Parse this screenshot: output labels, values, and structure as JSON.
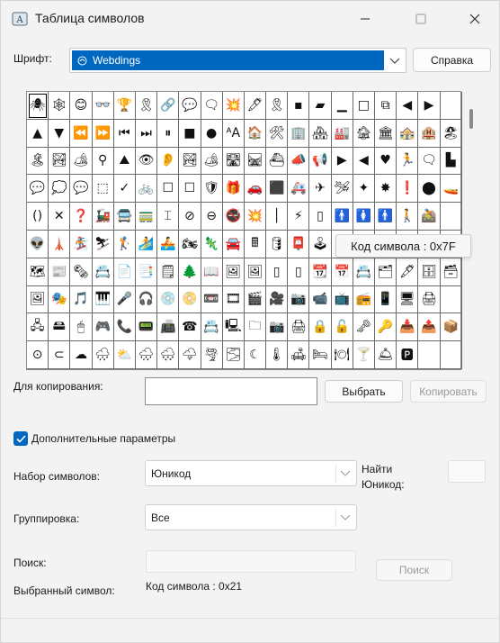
{
  "window": {
    "title": "Таблица символов",
    "icon": "character-map-icon"
  },
  "font": {
    "label": "Шрифт:",
    "value": "Webdings",
    "help_button": "Справка"
  },
  "grid": {
    "selected_index": 0,
    "symbols": [
      "🕷",
      "🕸",
      "😊",
      "👓",
      "🏆",
      "🎗",
      "🔗",
      "💬",
      "🗨",
      "💥",
      "🖊",
      "🎗",
      "▪",
      "▰",
      "▁",
      "□",
      "⧉",
      "◀",
      "▶",
      "",
      "▲",
      "▼",
      "⏪",
      "⏩",
      "⏮",
      "⏭",
      "⏸",
      "■",
      "●",
      "ᴬA",
      "🏠",
      "🛠",
      "🏢",
      "🏘",
      "🏭",
      "🏚",
      "🏛",
      "🏤",
      "🏨",
      "🏖",
      "🏝",
      "🏞",
      "🏕",
      "⚲",
      "⛰",
      "👁",
      "👂",
      "🏞",
      "🏕",
      "🛣",
      "🛤",
      "⛴",
      "📣",
      "📢",
      "▶",
      "◀",
      "♥",
      "🏃",
      "🗨",
      "▙",
      "💬",
      "💭",
      "💬",
      "⬚",
      "✓",
      "🚲",
      "☐",
      "☐",
      "🛡",
      "🎁",
      "🚗",
      "⬛",
      "🚑",
      "✈",
      "🛩",
      "✦",
      "✸",
      "❗",
      "⬤",
      "🚤",
      "()",
      "✕",
      "❓",
      "🚂",
      "🚍",
      "🚃",
      "⌶",
      "⊘",
      "⊖",
      "🚭",
      "💥",
      "│",
      "⚡",
      "▯",
      "🚹",
      "🚺",
      "🚹",
      "🚶",
      "🚵",
      "",
      "👽",
      "🗼",
      "🏂",
      "⛷",
      "🏌",
      "🏄",
      "🚣",
      "🏍",
      "🦎",
      "🚘",
      "🖩",
      "🛢",
      "📮",
      "🕹",
      "🕹",
      "",
      "",
      "",
      "",
      "",
      "🗺",
      "📰",
      "🗞",
      "📇",
      "📄",
      "📑",
      "🗒",
      "🌲",
      "📖",
      "🖼",
      "🖼",
      "▯",
      "▯",
      "📆",
      "📅",
      "📇",
      "🗂",
      "🖋",
      "🗄",
      "🗃",
      "🖼",
      "🎭",
      "🎵",
      "🎹",
      "🎤",
      "🎧",
      "💿",
      "📀",
      "📼",
      "🎞",
      "🎬",
      "🎥",
      "📷",
      "📹",
      "📺",
      "📻",
      "📱",
      "🖥",
      "🖨",
      "",
      "🖧",
      "🖴",
      "🖱",
      "🎮",
      "📞",
      "📟",
      "📠",
      "☎",
      "📇",
      "🖳",
      "🗀",
      "📷",
      "🖨",
      "🔒",
      "🔓",
      "🗝",
      "🔑",
      "📥",
      "📤",
      "📦",
      "⊙",
      "⊂",
      "☁",
      "🌧",
      "⛅",
      "🌧",
      "🌨",
      "🌩",
      "🌪",
      "🌫",
      "☾",
      "🌡",
      "🛋",
      "🛏",
      "🍽",
      "🍸",
      "🛎",
      "🅿",
      "",
      ""
    ]
  },
  "tooltip": {
    "text": "Код символа : 0x7F"
  },
  "copy": {
    "label": "Для копирования:",
    "value": "",
    "select_button": "Выбрать",
    "copy_button": "Копировать"
  },
  "advanced": {
    "checkbox_label": "Дополнительные параметры",
    "checked": true
  },
  "charset": {
    "label": "Набор символов:",
    "value": "Юникод",
    "goto_label_line1": "Найти",
    "goto_label_line2": "Юникод:",
    "goto_value": ""
  },
  "grouping": {
    "label": "Группировка:",
    "value": "Все"
  },
  "search": {
    "label": "Поиск:",
    "value": "",
    "button": "Поиск"
  },
  "selected": {
    "label": "Выбранный символ:",
    "code_text": "Код символа : 0x21"
  },
  "colors": {
    "accent": "#0067c0",
    "window_bg": "#f3f3f3"
  }
}
